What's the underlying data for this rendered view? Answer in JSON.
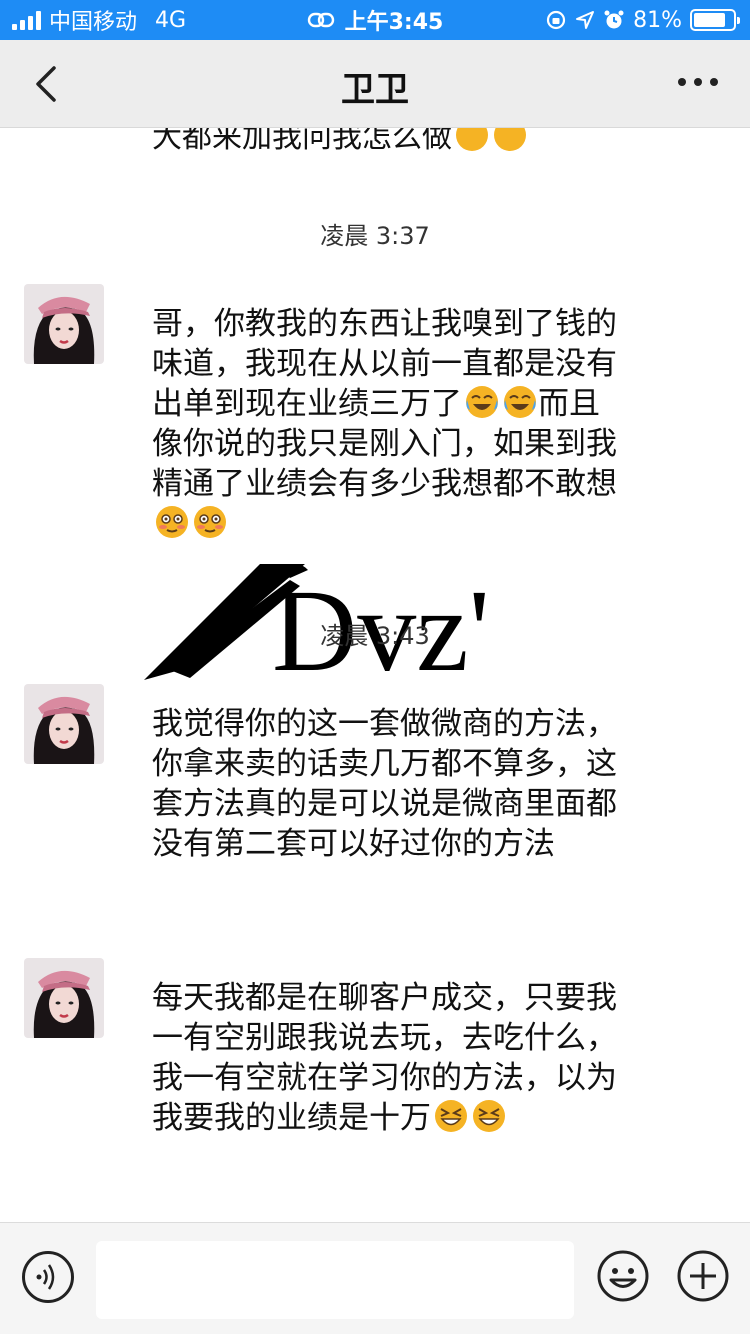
{
  "status_bar": {
    "carrier": "中国移动",
    "network": "4G",
    "time": "上午3:45",
    "battery_percent": "81%",
    "battery_level": 0.81,
    "icons": [
      "signal-icon",
      "link-icon",
      "rotation-lock-icon",
      "location-icon",
      "alarm-icon",
      "battery-icon"
    ]
  },
  "nav": {
    "title": "卫卫",
    "back_icon": "chevron-left-icon",
    "more_icon": "more-dots-icon"
  },
  "chat": {
    "cutoff_text": "大都来加我问我怎么做",
    "groups": [
      {
        "timestamp": "凌晨 3:37",
        "messages": [
          {
            "text": "哥，你教我的东西让我嗅到了钱的味道，我现在从以前一直都是没有出单到现在业绩三万了",
            "text2": "而且像你说的我只是刚入门，如果到我精通了业绩会有多少我想都不敢想",
            "emoji1": "tears-of-joy-emoji",
            "emoji2": "flushed-emoji"
          }
        ]
      },
      {
        "timestamp": "凌晨 3:43",
        "messages": [
          {
            "text": "我觉得你的这一套做微商的方法，你拿来卖的话卖几万都不算多，这套方法真的是可以说是微商里面都没有第二套可以好过你的方法"
          },
          {
            "text": "每天我都是在聊客户成交，只要我一有空别跟我说去玩，去吃什么，我一有空就在学习你的方法，以为我要我的业绩是十万",
            "emoji": "grinning-squint-emoji"
          }
        ]
      }
    ],
    "watermark": "Dvz'"
  },
  "input_bar": {
    "voice_icon": "voice-icon",
    "input_value": "",
    "emoji_icon": "smiley-icon",
    "plus_icon": "plus-icon"
  },
  "colors": {
    "status_bar_bg": "#1e8cf5",
    "nav_bg": "#ededed",
    "chat_bg": "#ffffff",
    "input_bar_bg": "#f5f5f5"
  }
}
